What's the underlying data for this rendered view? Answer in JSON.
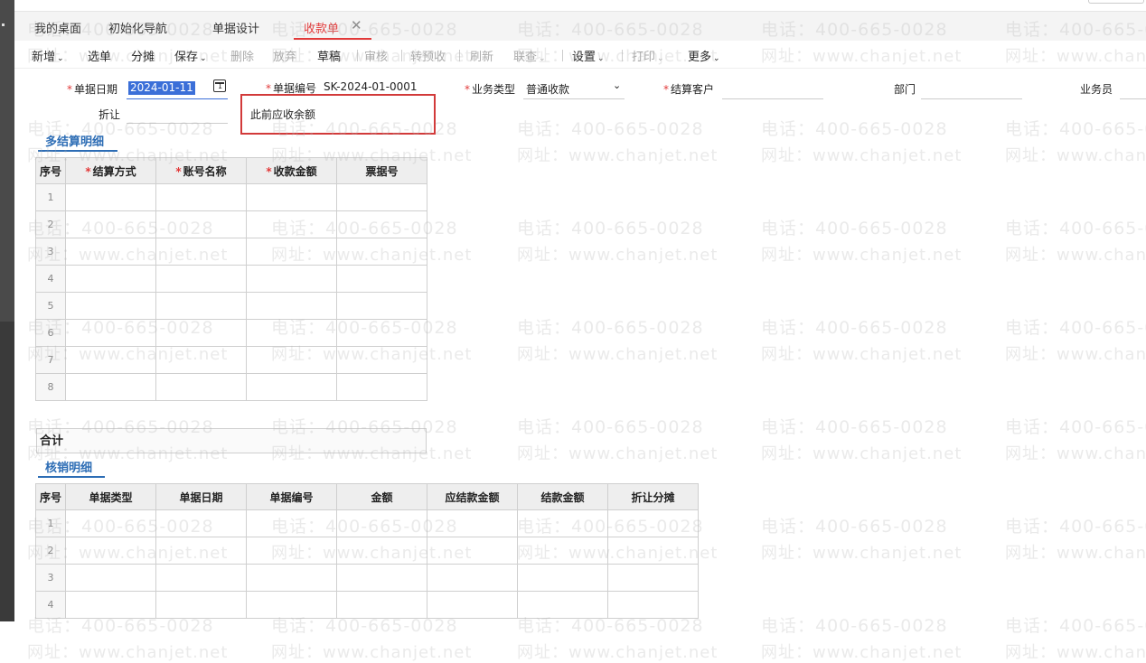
{
  "tabs": [
    {
      "label": "我的桌面"
    },
    {
      "label": "初始化导航"
    },
    {
      "label": "单据设计"
    },
    {
      "label": "收款单",
      "active": true
    }
  ],
  "tab_close_glyph": "✕",
  "toolbar": {
    "items": [
      {
        "label": "新增",
        "dropdown": true
      },
      {
        "label": "选单"
      },
      {
        "label": "分摊"
      },
      {
        "label": "保存",
        "dropdown": true
      },
      {
        "label": "删除",
        "disabled": true
      },
      {
        "label": "放弃",
        "disabled": true
      },
      {
        "label": "草稿"
      },
      {
        "label": "审核",
        "disabled": true
      },
      {
        "label": "转预收",
        "disabled": true
      },
      {
        "label": "刷新",
        "disabled": true
      },
      {
        "label": "联查",
        "dropdown": true,
        "disabled": true
      },
      {
        "label": "设置",
        "dropdown": true
      },
      {
        "label": "打印",
        "dropdown": true,
        "disabled": true
      },
      {
        "label": "更多",
        "dropdown": true
      }
    ]
  },
  "form": {
    "date_label": "单据日期",
    "date_value": "2024-01-11",
    "number_label": "单据编号",
    "number_value": "SK-2024-01-0001",
    "biz_type_label": "业务类型",
    "biz_type_value": "普通收款",
    "customer_label": "结算客户",
    "dept_label": "部门",
    "salesman_label": "业务员",
    "discount_label": "折让",
    "prev_receivable_label": "此前应收余额"
  },
  "settlement": {
    "title": "多结算明细",
    "headers": [
      {
        "label": "序号",
        "required": false
      },
      {
        "label": "结算方式",
        "required": true
      },
      {
        "label": "账号名称",
        "required": true
      },
      {
        "label": "收款金额",
        "required": true
      },
      {
        "label": "票据号",
        "required": false
      }
    ],
    "rows": [
      "1",
      "2",
      "3",
      "4",
      "5",
      "6",
      "7",
      "8"
    ]
  },
  "total_label": "合计",
  "writeoff": {
    "title": "核销明细",
    "headers": [
      "序号",
      "单据类型",
      "单据日期",
      "单据编号",
      "金额",
      "应结款金额",
      "结款金额",
      "折让分摊"
    ],
    "rows": [
      "1",
      "2",
      "3",
      "4"
    ]
  },
  "watermark": {
    "phone": "电话：400-665-0028",
    "url": "网址：www.chanjet.net"
  },
  "colors": {
    "accent_red": "#e23a3a",
    "accent_blue": "#2d6db5",
    "selection": "#3b6fd8"
  }
}
